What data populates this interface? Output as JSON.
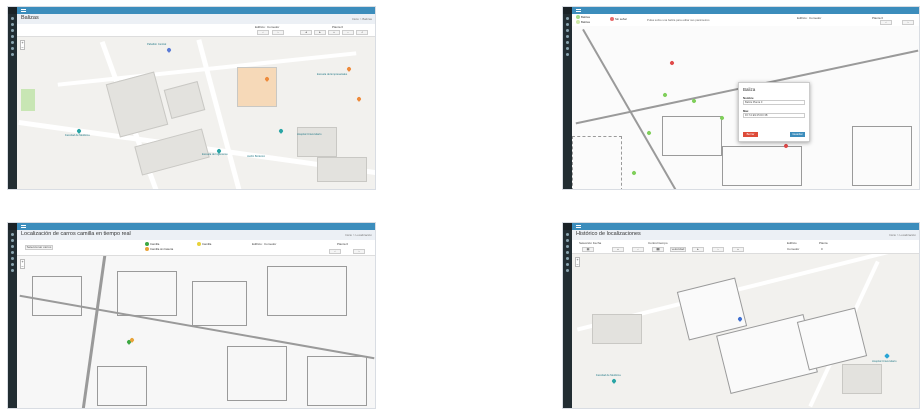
{
  "panel1": {
    "title": "Balizas",
    "crumbs": "Inicio > Balizas",
    "building_label": "Edificio:",
    "building_value": "Comedor",
    "floor_label": "Planta 0",
    "map_labels": [
      "Pabellón Central",
      "Facultad de Medicina",
      "Escuela de Ingenieros",
      "Hospital Universitario",
      "Escuela de Empresariales",
      "Jardín Botánico"
    ]
  },
  "panel2": {
    "legend": [
      "Balizas",
      "Balizas",
      "Sin señal"
    ],
    "hint": "Pulsa sobre una baliza para editar sus parámetros",
    "building_label": "Edificio:",
    "building_value": "Comedor",
    "floor_label": "Planta 0",
    "modal": {
      "title": "Baliza",
      "name_label": "Nombre",
      "name_value": "Baliza Planta 0",
      "mac_label": "Mac",
      "mac_value": "FF:7A:E9:25:D0:3B",
      "delete_label": "Borrar",
      "save_label": "Guardar"
    }
  },
  "panel3": {
    "title": "Localización de carros camilla en tiempo real",
    "crumbs": "Inicio > Localización",
    "button_label": "Seleccionar carros",
    "legend": [
      "Camilla",
      "Camilla",
      "Camilla sin batería"
    ],
    "building_label": "Edificio:",
    "building_value": "Comedor",
    "floor_label": "Planta 0"
  },
  "panel4": {
    "title": "Histórico de localizaciones",
    "crumbs": "Inicio > Localización",
    "date_label": "Selección Fecha",
    "control_label": "Control tiempo",
    "speed_label": "velocidad",
    "building_label": "Edificio",
    "building_value": "Comedor",
    "floor_label": "Planta",
    "floor_value": "0",
    "map_labels": [
      "Facultad de Medicina",
      "Hospital Universitario"
    ]
  },
  "colors": {
    "sidebar": "#222d32",
    "topbar": "#3c8dbc",
    "beacon_green": "#7fcf5a",
    "beacon_red": "#e04a4a"
  }
}
